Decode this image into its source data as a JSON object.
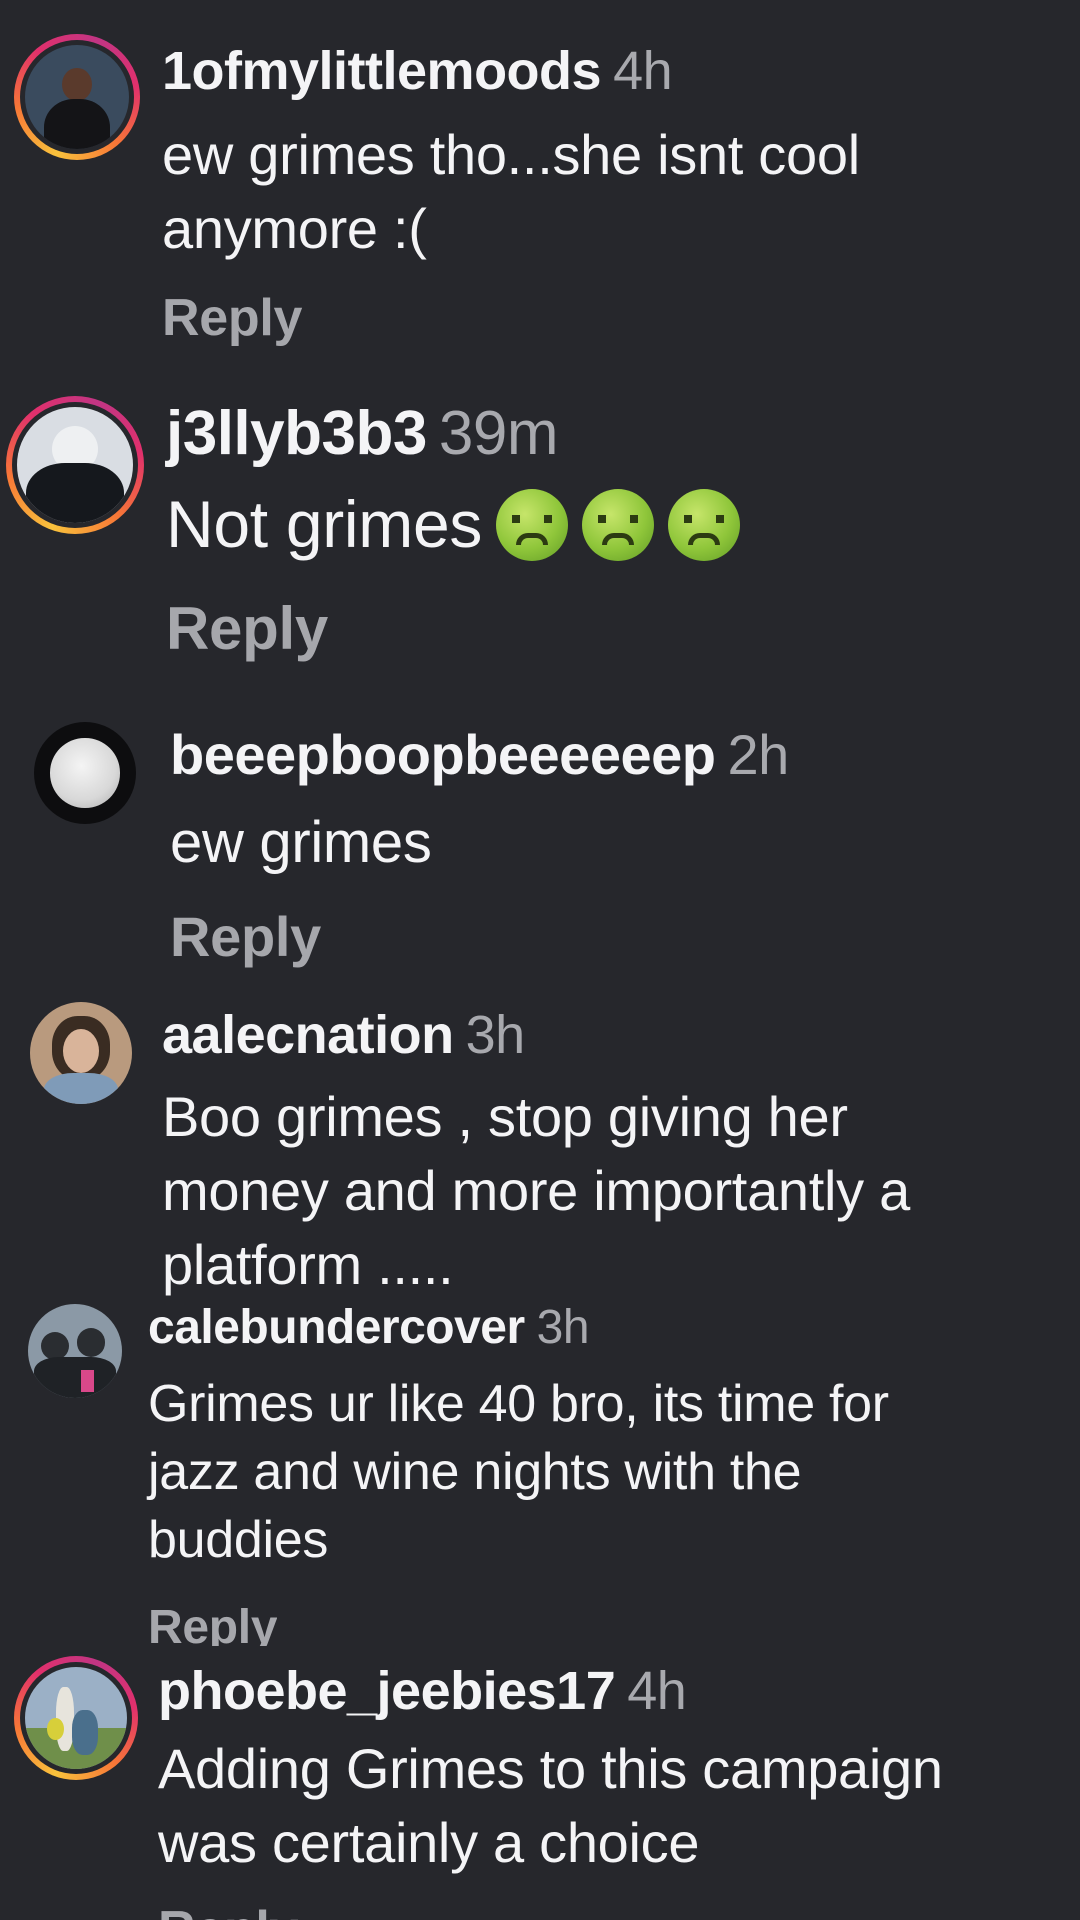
{
  "comments": [
    {
      "username": "1ofmylittlemoods",
      "time": "4h",
      "text": "ew grimes tho...she isnt cool\nanymore :(",
      "reply_label": "Reply",
      "avatar": {
        "story_ring": true,
        "bg": "#3a4b5e",
        "accent": "#1b1b1f"
      }
    },
    {
      "username": "j3llyb3b3",
      "time": "39m",
      "text": "Not grimes",
      "emojis": [
        "nauseated-face-emoji",
        "nauseated-face-emoji",
        "nauseated-face-emoji"
      ],
      "reply_label": "Reply",
      "avatar": {
        "story_ring": true,
        "bg": "#d9dde3",
        "accent": "#15181d"
      }
    },
    {
      "username": "beeepboopbeeeeeep",
      "time": "2h",
      "text": "ew grimes",
      "reply_label": "Reply",
      "avatar": {
        "story_ring": false,
        "bg": "#0d0d0f",
        "accent": "#e6e6e6"
      }
    },
    {
      "username": "aalecnation",
      "time": "3h",
      "text": "Boo grimes , stop giving her\nmoney and more importantly a\nplatform .....",
      "reply_label": "",
      "avatar": {
        "story_ring": false,
        "bg": "#b99a7e",
        "accent": "#3a2c22"
      }
    },
    {
      "username": "calebundercover",
      "time": "3h",
      "text": "Grimes ur like 40 bro, its time for\njazz and wine nights with the\nbuddies",
      "reply_label": "Reply",
      "avatar": {
        "story_ring": false,
        "bg": "#8b99a6",
        "accent": "#1f2226"
      }
    },
    {
      "username": "phoebe_jeebies17",
      "time": "4h",
      "text": "Adding Grimes to this campaign\nwas certainly a choice",
      "reply_label": "Reply",
      "avatar": {
        "story_ring": true,
        "bg": "#9bb0c6",
        "accent": "#4a6f8c"
      }
    }
  ]
}
